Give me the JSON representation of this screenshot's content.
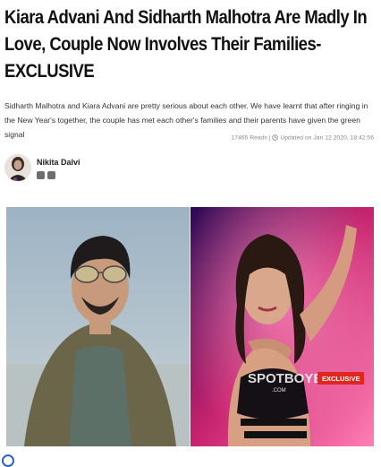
{
  "article": {
    "headline": "Kiara Advani And Sidharth Malhotra Are Madly In Love, Couple Now Involves Their Families- EXCLUSIVE",
    "summary": "Sidharth Malhotra and Kiara Advani are pretty serious about each other. We have learnt that after ringing in the New Year's together, the couple has met each other's families and their parents have given the green signal",
    "reads": "17465 Reads |",
    "updated": "Updated on Jan 12 2020, 18:42:56"
  },
  "author": {
    "name": "Nikita Dalvi",
    "social_icons": [
      "facebook-icon",
      "twitter-icon"
    ]
  },
  "image": {
    "watermark": "SPOTBOYE",
    "watermark_sub": ".COM",
    "badge": "EXCLUSIVE"
  },
  "colors": {
    "link_blue": "#2a63c7",
    "badge_bg": "#e0261f"
  }
}
